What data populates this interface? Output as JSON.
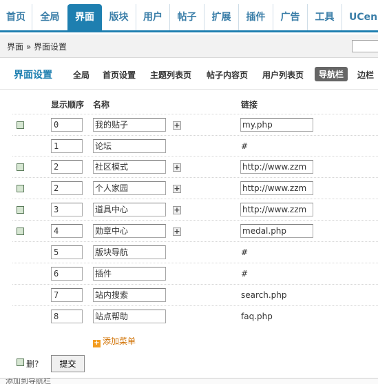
{
  "topnav": {
    "tabs": [
      {
        "label": "首页",
        "active": false
      },
      {
        "label": "全局",
        "active": false
      },
      {
        "label": "界面",
        "active": true
      },
      {
        "label": "版块",
        "active": false
      },
      {
        "label": "用户",
        "active": false
      },
      {
        "label": "帖子",
        "active": false
      },
      {
        "label": "扩展",
        "active": false
      },
      {
        "label": "插件",
        "active": false
      },
      {
        "label": "广告",
        "active": false
      },
      {
        "label": "工具",
        "active": false
      },
      {
        "label": "UCen",
        "active": false
      }
    ]
  },
  "breadcrumb": "界面 » 界面设置",
  "subheader": {
    "title": "界面设置",
    "tabs": [
      {
        "label": "全局",
        "active": false
      },
      {
        "label": "首页设置",
        "active": false
      },
      {
        "label": "主题列表页",
        "active": false
      },
      {
        "label": "帖子内容页",
        "active": false
      },
      {
        "label": "用户列表页",
        "active": false
      },
      {
        "label": "导航栏",
        "active": true
      },
      {
        "label": "边栏",
        "active": false
      }
    ]
  },
  "table": {
    "headers": {
      "order": "显示顺序",
      "name": "名称",
      "link": "链接"
    },
    "rows": [
      {
        "checkbox": true,
        "order": "0",
        "name": "我的贴子",
        "expand": true,
        "link": "my.php",
        "link_editable": true
      },
      {
        "checkbox": false,
        "order": "1",
        "name": "论坛",
        "expand": false,
        "link": "#",
        "link_editable": false
      },
      {
        "checkbox": true,
        "order": "2",
        "name": "社区模式",
        "expand": true,
        "link": "http://www.zzm",
        "link_editable": true
      },
      {
        "checkbox": true,
        "order": "2",
        "name": "个人家园",
        "expand": true,
        "link": "http://www.zzm",
        "link_editable": true
      },
      {
        "checkbox": true,
        "order": "3",
        "name": "道具中心",
        "expand": true,
        "link": "http://www.zzm",
        "link_editable": true
      },
      {
        "checkbox": true,
        "order": "4",
        "name": "勋章中心",
        "expand": true,
        "link": "medal.php",
        "link_editable": true
      },
      {
        "checkbox": false,
        "order": "5",
        "name": "版块导航",
        "expand": false,
        "link": "#",
        "link_editable": false
      },
      {
        "checkbox": false,
        "order": "6",
        "name": "插件",
        "expand": false,
        "link": "#",
        "link_editable": false
      },
      {
        "checkbox": false,
        "order": "7",
        "name": "站内搜索",
        "expand": false,
        "link": "search.php",
        "link_editable": false
      },
      {
        "checkbox": false,
        "order": "8",
        "name": "站点帮助",
        "expand": false,
        "link": "faq.php",
        "link_editable": false
      }
    ]
  },
  "add_menu_label": "添加菜单",
  "delete_label": "删?",
  "submit_label": "提交",
  "bottom_text": "添加到导航栏",
  "colors": {
    "accent": "#1e7fb0",
    "add_link": "#d07000"
  }
}
